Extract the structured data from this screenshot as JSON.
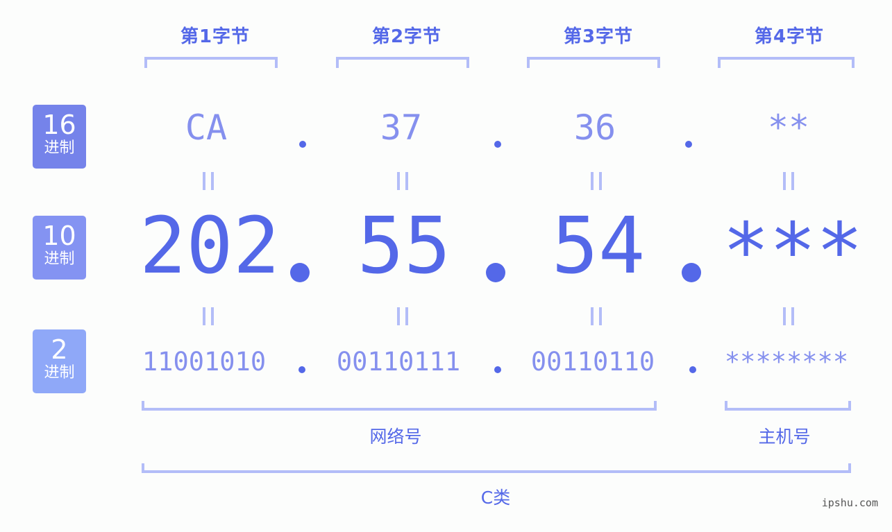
{
  "byte_labels": [
    "第1字节",
    "第2字节",
    "第3字节",
    "第4字节"
  ],
  "badges": [
    {
      "num": "16",
      "unit": "进制",
      "color": "#7583ea"
    },
    {
      "num": "10",
      "unit": "进制",
      "color": "#8493f2"
    },
    {
      "num": "2",
      "unit": "进制",
      "color": "#8fa8f8"
    }
  ],
  "hex": [
    "CA",
    "37",
    "36",
    "**"
  ],
  "decimal": [
    "202",
    "55",
    "54",
    "***"
  ],
  "binary": [
    "11001010",
    "00110111",
    "00110110",
    "********"
  ],
  "separator": ".",
  "groups": {
    "network": "网络号",
    "host": "主机号",
    "class": "C类"
  },
  "watermark": "ipshu.com",
  "colors": {
    "accent": "#5468e8",
    "light": "#8590ee",
    "bracket": "#b3bdf8"
  }
}
